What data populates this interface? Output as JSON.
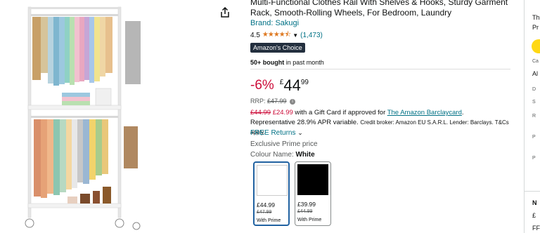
{
  "product": {
    "title": "Multi-Functional Clothes Rail With Shelves & Hooks, Sturdy Garment Rack, Smooth-Rolling Wheels, For Bedroom, Laundry",
    "brand": "Brand: Sakugi",
    "rating_value": "4.5",
    "stars": "★★★★⯪",
    "rating_count": "(1,473)",
    "badge": "Amazon's Choice",
    "bought_bold": "50+ bought",
    "bought_rest": " in past month"
  },
  "price": {
    "discount": "-6%",
    "currency": "£",
    "whole": "44",
    "fraction": "99",
    "rrp_label": "RRP: ",
    "rrp_value": "£47.99"
  },
  "gift": {
    "old_price": "£44.99",
    "new_price": "£24.99",
    "text1": " with a Gift Card if approved for ",
    "link": "The Amazon Barclaycard",
    "text2": ". Representative 28.9% APR variable. ",
    "small": "Credit broker: Amazon EU S.A.R.L. Lender: Barclays. T&Cs apply."
  },
  "returns": "FREE Returns",
  "exclusive": "Exclusive Prime price",
  "colour": {
    "label": "Colour Name: ",
    "value": "White"
  },
  "swatches": [
    {
      "price": "£44.99",
      "rrp": "£47.99",
      "note": "With Prime",
      "color": "#ffffff"
    },
    {
      "price": "£39.99",
      "rrp": "£44.99",
      "note": "With Prime",
      "color": "#000000"
    }
  ],
  "right_col": {
    "r1": "Th",
    "r2": "Pr",
    "r3": "Ca",
    "r4": "Al",
    "r5": "D",
    "r6": "S",
    "r7": "R",
    "r8": "P",
    "r9": "P",
    "r10": "N",
    "r11": "£",
    "r12": "FF"
  }
}
